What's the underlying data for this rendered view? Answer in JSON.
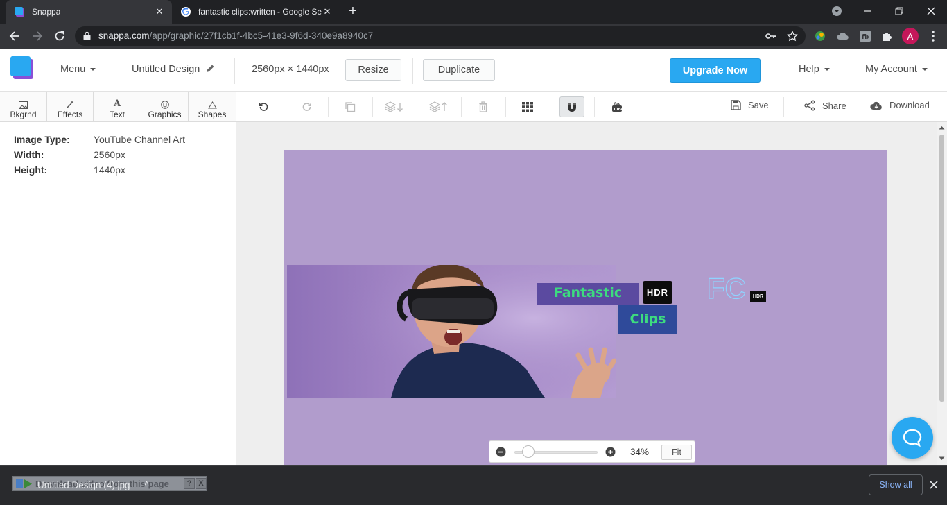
{
  "browser": {
    "tabs": [
      {
        "title": "Snappa",
        "active": true
      },
      {
        "title": "fantastic clips:written - Google Se",
        "active": false
      }
    ],
    "url_host": "snappa.com",
    "url_path": "/app/graphic/27f1cb1f-4bc5-41e3-9f6d-340e9a8940c7",
    "profile_initial": "A"
  },
  "header": {
    "menu": "Menu",
    "design_title": "Untitled Design",
    "dimensions": "2560px × 1440px",
    "resize": "Resize",
    "duplicate": "Duplicate",
    "upgrade": "Upgrade Now",
    "help": "Help",
    "account": "My Account"
  },
  "left_tabs": [
    {
      "label": "Bkgrnd",
      "icon": "image-icon"
    },
    {
      "label": "Effects",
      "icon": "wand-icon"
    },
    {
      "label": "Text",
      "icon": "text-icon"
    },
    {
      "label": "Graphics",
      "icon": "smiley-icon"
    },
    {
      "label": "Shapes",
      "icon": "triangle-icon"
    }
  ],
  "image_info": {
    "type_label": "Image Type:",
    "type_value": "YouTube Channel Art",
    "width_label": "Width:",
    "width_value": "2560px",
    "height_label": "Height:",
    "height_value": "1440px"
  },
  "editor_actions": {
    "save": "Save",
    "share": "Share",
    "download": "Download"
  },
  "canvas": {
    "background": "#b19ccc",
    "text_fantastic": "Fantastic",
    "text_clips": "Clips",
    "badge_hdr": "HDR",
    "logo_letters": "FC",
    "logo_badge": "HDR"
  },
  "zoom": {
    "percent": "34%",
    "fit": "Fit",
    "level": 0.1
  },
  "download_shelf": {
    "filename": "Untitled Design (4).jpg",
    "popup_text": "Download video from this page",
    "popup_help": "?",
    "popup_close": "X",
    "show_all": "Show all"
  },
  "colors": {
    "accent": "#29a8f1",
    "text_green": "#3ddc7f",
    "fantastic_bg": "#5b4aa0",
    "clips_bg": "#2f4a9a"
  }
}
